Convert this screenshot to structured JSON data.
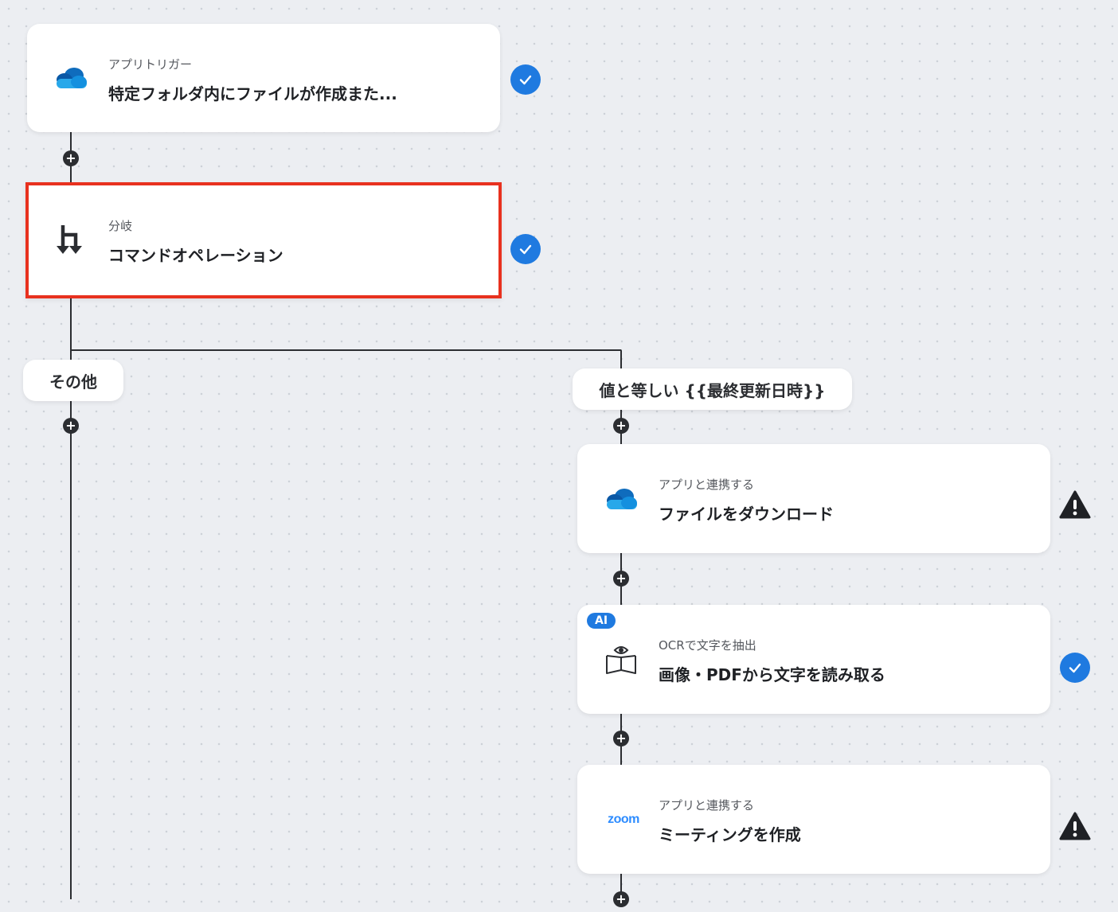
{
  "trigger": {
    "sublabel": "アプリトリガー",
    "title": "特定フォルダ内にファイルが作成また..."
  },
  "branch": {
    "sublabel": "分岐",
    "title": "コマンドオペレーション"
  },
  "branches": {
    "other_label": "その他",
    "equals_label": "値と等しい {{最終更新日時}}"
  },
  "steps": [
    {
      "sublabel": "アプリと連携する",
      "title": "ファイルをダウンロード"
    },
    {
      "badge": "AI",
      "sublabel": "OCRで文字を抽出",
      "title": "画像・PDFから文字を読み取る"
    },
    {
      "sublabel": "アプリと連携する",
      "title": "ミーティングを作成",
      "logo_text": "zoom"
    }
  ],
  "colors": {
    "accent": "#1f7ae0",
    "selected_border": "#e8311f",
    "line": "#2b2d31",
    "onedrive_blue": "#0f6cbd",
    "zoom_blue": "#2d8cff"
  },
  "icons": {
    "trigger": "onedrive-cloud-icon",
    "branch": "branch-arrows-icon",
    "step1": "onedrive-cloud-icon",
    "step2": "book-eye-ocr-icon",
    "step3": "zoom-logo-icon",
    "success": "check-circle-icon",
    "warning": "warning-triangle-icon",
    "add": "plus-icon"
  }
}
